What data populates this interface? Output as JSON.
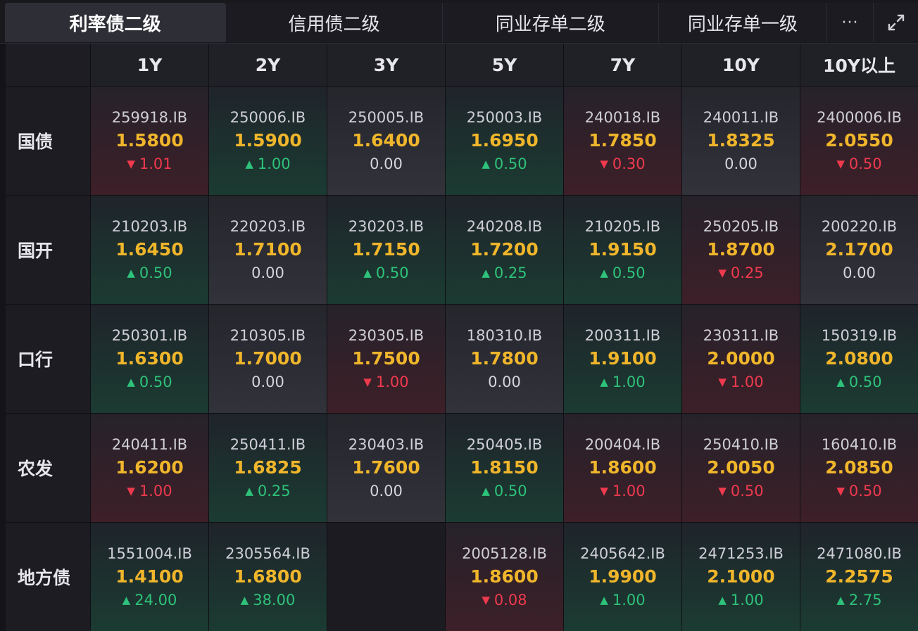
{
  "tabs": [
    "利率债二级",
    "信用债二级",
    "同业存单二级",
    "同业存单一级"
  ],
  "more_label": "···",
  "columns": [
    "1Y",
    "2Y",
    "3Y",
    "5Y",
    "7Y",
    "10Y",
    "10Y以上"
  ],
  "rows": [
    {
      "label": "国债",
      "cells": [
        {
          "code": "259918.IB",
          "yield": "1.5800",
          "change": "1.01",
          "dir": "down"
        },
        {
          "code": "250006.IB",
          "yield": "1.5900",
          "change": "1.00",
          "dir": "up"
        },
        {
          "code": "250005.IB",
          "yield": "1.6400",
          "change": "0.00",
          "dir": "flat"
        },
        {
          "code": "250003.IB",
          "yield": "1.6950",
          "change": "0.50",
          "dir": "up"
        },
        {
          "code": "240018.IB",
          "yield": "1.7850",
          "change": "0.30",
          "dir": "down"
        },
        {
          "code": "240011.IB",
          "yield": "1.8325",
          "change": "0.00",
          "dir": "flat"
        },
        {
          "code": "2400006.IB",
          "yield": "2.0550",
          "change": "0.50",
          "dir": "down"
        }
      ]
    },
    {
      "label": "国开",
      "cells": [
        {
          "code": "210203.IB",
          "yield": "1.6450",
          "change": "0.50",
          "dir": "up"
        },
        {
          "code": "220203.IB",
          "yield": "1.7100",
          "change": "0.00",
          "dir": "flat"
        },
        {
          "code": "230203.IB",
          "yield": "1.7150",
          "change": "0.50",
          "dir": "up"
        },
        {
          "code": "240208.IB",
          "yield": "1.7200",
          "change": "0.25",
          "dir": "up"
        },
        {
          "code": "210205.IB",
          "yield": "1.9150",
          "change": "0.50",
          "dir": "up"
        },
        {
          "code": "250205.IB",
          "yield": "1.8700",
          "change": "0.25",
          "dir": "down"
        },
        {
          "code": "200220.IB",
          "yield": "2.1700",
          "change": "0.00",
          "dir": "flat"
        }
      ]
    },
    {
      "label": "口行",
      "cells": [
        {
          "code": "250301.IB",
          "yield": "1.6300",
          "change": "0.50",
          "dir": "up"
        },
        {
          "code": "210305.IB",
          "yield": "1.7000",
          "change": "0.00",
          "dir": "flat"
        },
        {
          "code": "230305.IB",
          "yield": "1.7500",
          "change": "1.00",
          "dir": "down"
        },
        {
          "code": "180310.IB",
          "yield": "1.7800",
          "change": "0.00",
          "dir": "flat"
        },
        {
          "code": "200311.IB",
          "yield": "1.9100",
          "change": "1.00",
          "dir": "up"
        },
        {
          "code": "230311.IB",
          "yield": "2.0000",
          "change": "1.00",
          "dir": "down"
        },
        {
          "code": "150319.IB",
          "yield": "2.0800",
          "change": "0.50",
          "dir": "up"
        }
      ]
    },
    {
      "label": "农发",
      "cells": [
        {
          "code": "240411.IB",
          "yield": "1.6200",
          "change": "1.00",
          "dir": "down"
        },
        {
          "code": "250411.IB",
          "yield": "1.6825",
          "change": "0.25",
          "dir": "up"
        },
        {
          "code": "230403.IB",
          "yield": "1.7600",
          "change": "0.00",
          "dir": "flat"
        },
        {
          "code": "250405.IB",
          "yield": "1.8150",
          "change": "0.50",
          "dir": "up"
        },
        {
          "code": "200404.IB",
          "yield": "1.8600",
          "change": "1.00",
          "dir": "down"
        },
        {
          "code": "250410.IB",
          "yield": "2.0050",
          "change": "0.50",
          "dir": "down"
        },
        {
          "code": "160410.IB",
          "yield": "2.0850",
          "change": "0.50",
          "dir": "down"
        }
      ]
    },
    {
      "label": "地方债",
      "cells": [
        {
          "code": "1551004.IB",
          "yield": "1.4100",
          "change": "24.00",
          "dir": "up"
        },
        {
          "code": "2305564.IB",
          "yield": "1.6800",
          "change": "38.00",
          "dir": "up"
        },
        null,
        {
          "code": "2005128.IB",
          "yield": "1.8600",
          "change": "0.08",
          "dir": "down"
        },
        {
          "code": "2405642.IB",
          "yield": "1.9900",
          "change": "1.00",
          "dir": "up"
        },
        {
          "code": "2471253.IB",
          "yield": "2.1000",
          "change": "1.00",
          "dir": "up"
        },
        {
          "code": "2471080.IB",
          "yield": "2.2575",
          "change": "2.75",
          "dir": "up"
        }
      ]
    }
  ],
  "colors": {
    "up": "#2ec27a",
    "down": "#ee3a4e",
    "yield": "#f0b62b",
    "flat": "#d4d4da"
  },
  "icons": {
    "more": "more-dots-icon",
    "expand": "expand-icon",
    "up": "triangle-up-icon",
    "down": "triangle-down-icon"
  }
}
